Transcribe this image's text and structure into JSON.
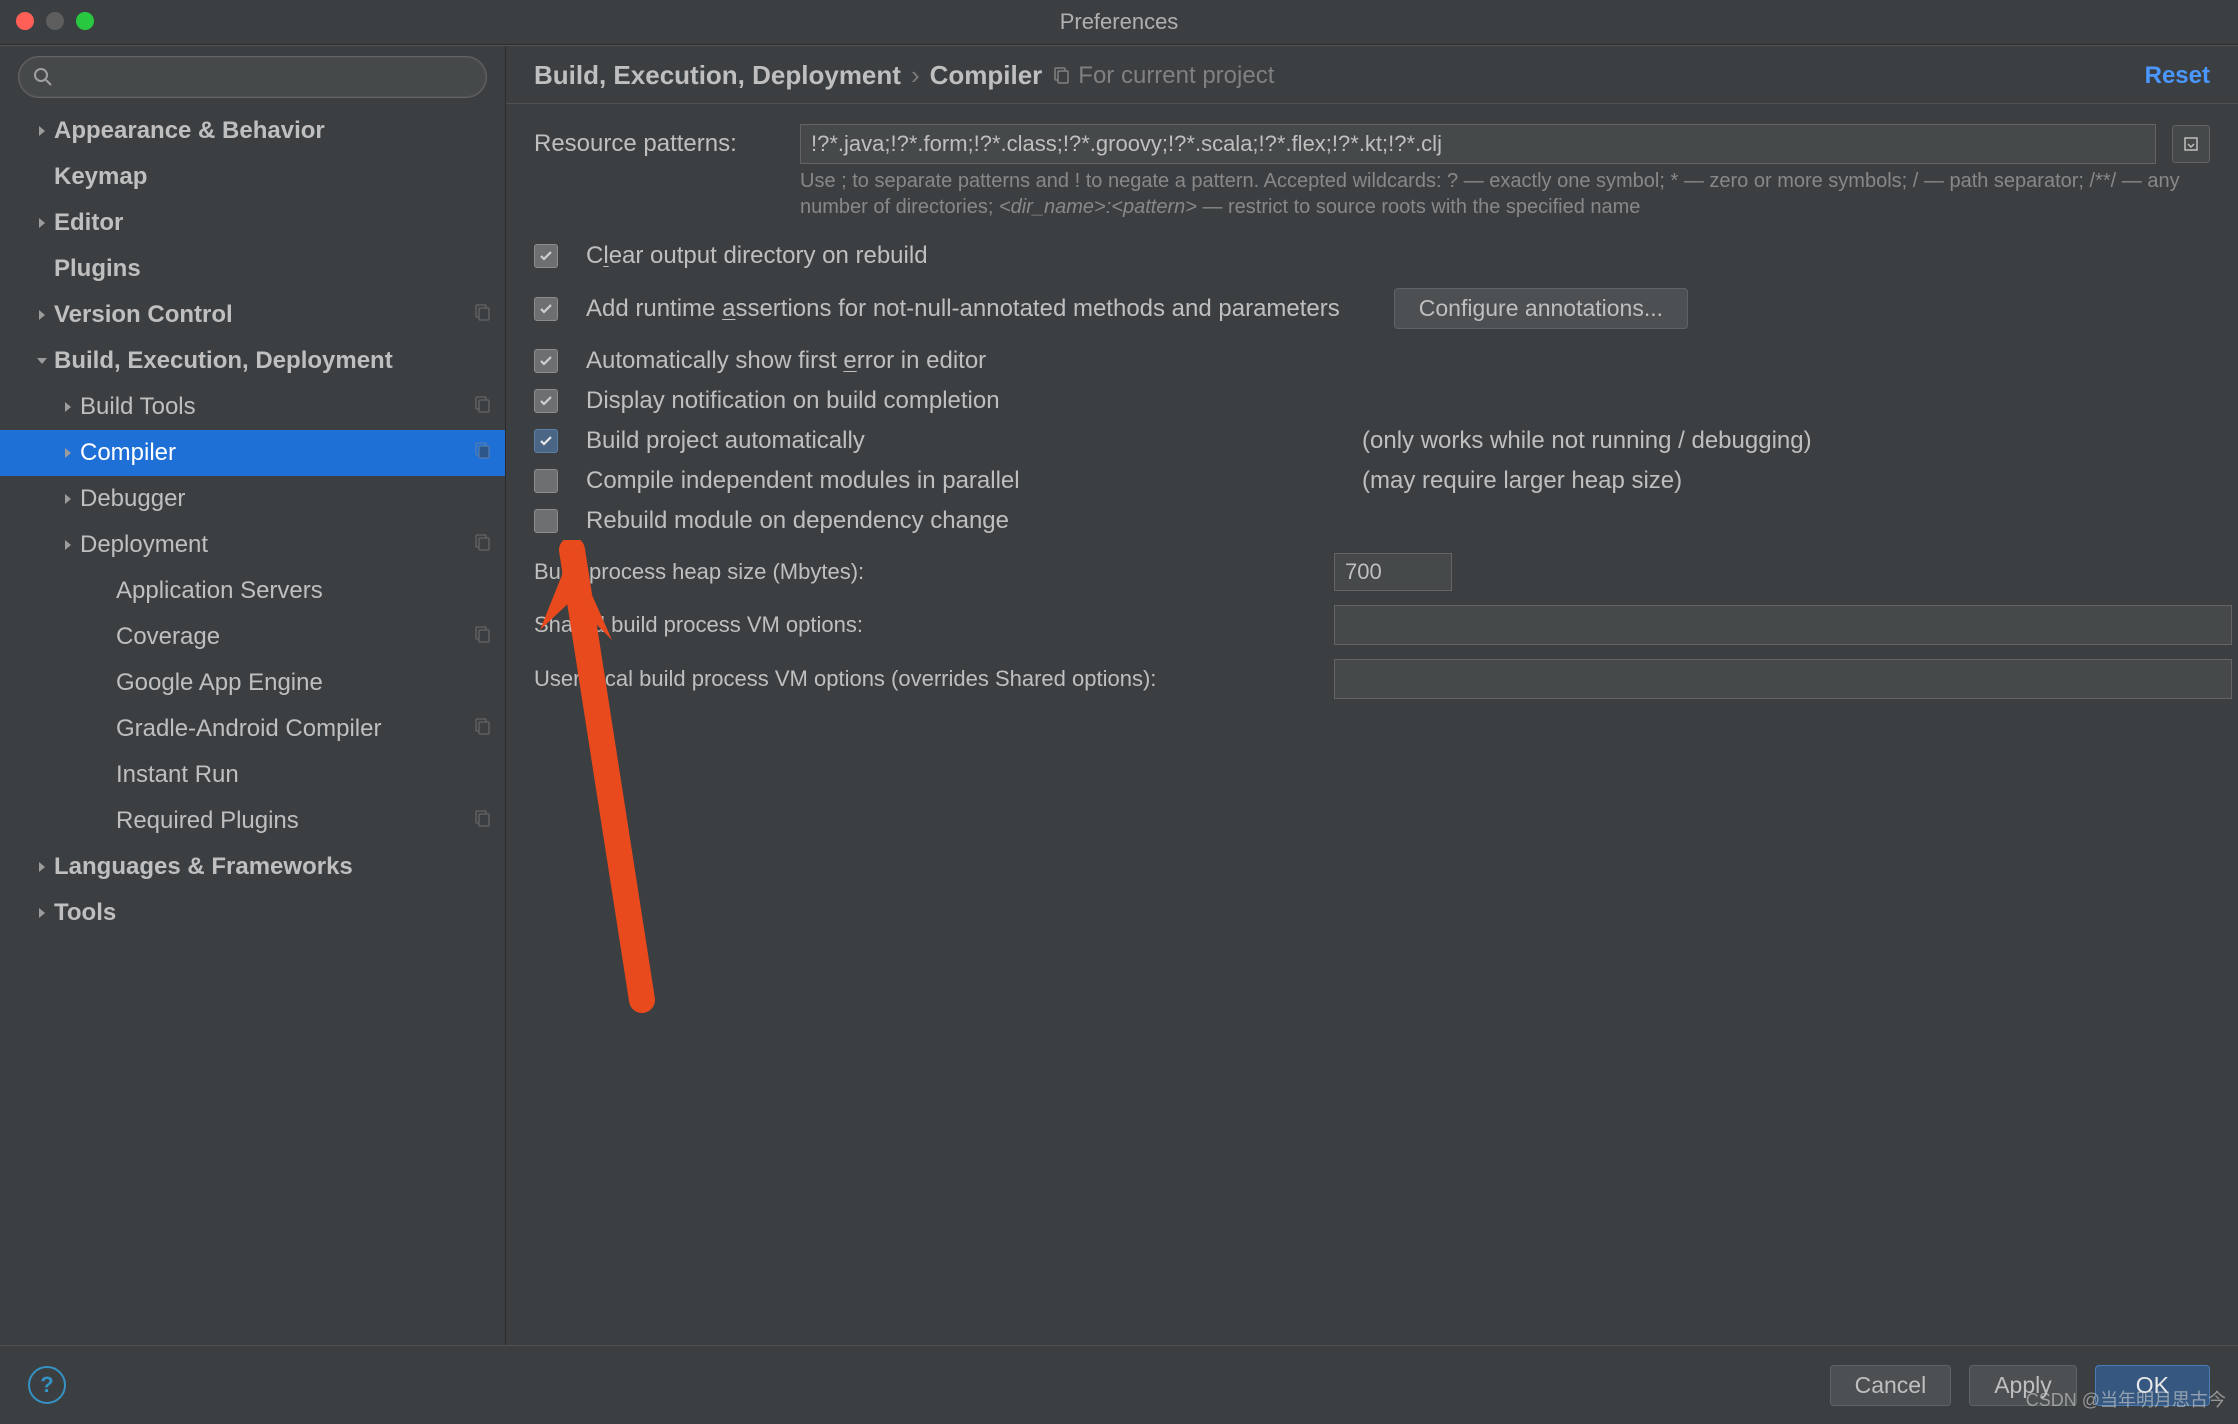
{
  "window": {
    "title": "Preferences"
  },
  "header": {
    "crumb1": "Build, Execution, Deployment",
    "crumb2": "Compiler",
    "scope": "For current project",
    "reset": "Reset"
  },
  "sidebar": {
    "items": [
      {
        "label": "Appearance & Behavior",
        "level": 1,
        "twisty": "right",
        "bold": true
      },
      {
        "label": "Keymap",
        "level": 1,
        "twisty": "",
        "bold": true
      },
      {
        "label": "Editor",
        "level": 1,
        "twisty": "right",
        "bold": true
      },
      {
        "label": "Plugins",
        "level": 1,
        "twisty": "",
        "bold": true
      },
      {
        "label": "Version Control",
        "level": 1,
        "twisty": "right",
        "bold": true,
        "copy": true
      },
      {
        "label": "Build, Execution, Deployment",
        "level": 1,
        "twisty": "down",
        "bold": true
      },
      {
        "label": "Build Tools",
        "level": 2,
        "twisty": "right",
        "copy": true
      },
      {
        "label": "Compiler",
        "level": 2,
        "twisty": "right",
        "selected": true,
        "copy": true
      },
      {
        "label": "Debugger",
        "level": 2,
        "twisty": "right"
      },
      {
        "label": "Deployment",
        "level": 2,
        "twisty": "right",
        "copy": true
      },
      {
        "label": "Application Servers",
        "level": 3
      },
      {
        "label": "Coverage",
        "level": 3,
        "copy": true
      },
      {
        "label": "Google App Engine",
        "level": 3
      },
      {
        "label": "Gradle-Android Compiler",
        "level": 3,
        "copy": true
      },
      {
        "label": "Instant Run",
        "level": 3
      },
      {
        "label": "Required Plugins",
        "level": 3,
        "copy": true
      },
      {
        "label": "Languages & Frameworks",
        "level": 1,
        "twisty": "right",
        "bold": true
      },
      {
        "label": "Tools",
        "level": 1,
        "twisty": "right",
        "bold": true
      }
    ]
  },
  "form": {
    "resource_patterns_label": "Resource patterns:",
    "resource_patterns_value": "!?*.java;!?*.form;!?*.class;!?*.groovy;!?*.scala;!?*.flex;!?*.kt;!?*.clj",
    "hint_prefix": "Use ; to separate patterns and ! to negate a pattern. Accepted wildcards: ? — exactly one symbol; * — zero or more symbols; / — path separator; /**/ — any number of directories; ",
    "hint_em": "<dir_name>:<pattern>",
    "hint_suffix": " — restrict to source roots with the specified name",
    "cb_clear": "Clear output directory on rebuild",
    "cb_assertions": "Add runtime assertions for not-null-annotated methods and parameters",
    "configure_btn": "Configure annotations...",
    "cb_show_error": "Automatically show first error in editor",
    "cb_notify": "Display notification on build completion",
    "cb_build_auto": "Build project automatically",
    "cb_build_auto_note": "(only works while not running / debugging)",
    "cb_parallel": "Compile independent modules in parallel",
    "cb_parallel_note": "(may require larger heap size)",
    "cb_rebuild_dep": "Rebuild module on dependency change",
    "heap_label": "Build process heap size (Mbytes):",
    "heap_value": "700",
    "shared_vm_label": "Shared build process VM options:",
    "shared_vm_value": "",
    "user_vm_label": "User-local build process VM options (overrides Shared options):",
    "user_vm_value": ""
  },
  "footer": {
    "cancel": "Cancel",
    "apply": "Apply",
    "ok": "OK"
  }
}
